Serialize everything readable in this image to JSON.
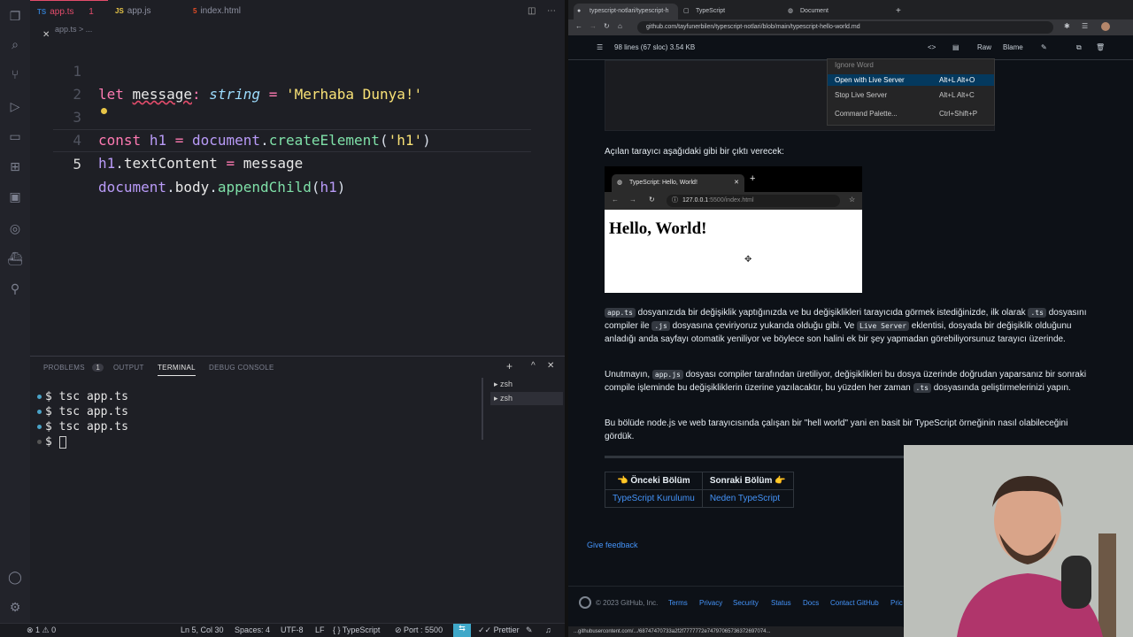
{
  "vscode": {
    "tabs": [
      {
        "icon": "TS",
        "label": "app.ts",
        "badge": "1",
        "active": true
      },
      {
        "icon": "JS",
        "label": "app.js",
        "active": false
      },
      {
        "icon": "5",
        "label": "index.html",
        "active": false
      }
    ],
    "breadcrumb": "app.ts > ...",
    "line_numbers": [
      "1",
      "2",
      "3",
      "4",
      "5"
    ],
    "code_lines": [
      "let message: string = 'Merhaba Dunya!'",
      "",
      "const h1 = document.createElement('h1')",
      "h1.textContent = message",
      "document.body.appendChild(h1)"
    ],
    "panel": {
      "tabs": [
        "PROBLEMS",
        "OUTPUT",
        "TERMINAL",
        "DEBUG CONSOLE"
      ],
      "problems_count": "1",
      "terminal_lines": [
        "$ tsc app.ts",
        "$ tsc app.ts",
        "$ tsc app.ts",
        "$"
      ],
      "shells": [
        "zsh",
        "zsh"
      ]
    },
    "status": {
      "errors": "⊗ 1 ⚠ 0",
      "position": "Ln 5, Col 30",
      "spaces": "Spaces: 4",
      "encoding": "UTF-8",
      "eol": "LF",
      "language": "{ } TypeScript",
      "port": "⊘ Port : 5500",
      "prettier": "✓✓ Prettier"
    }
  },
  "browser": {
    "tabs": [
      "typescript-notlari/typescript-h",
      "TypeScript",
      "Document"
    ],
    "url": "github.com/tayfunerbilen/typescript-notlari/blob/main/typescript-hello-world.md",
    "file_info": "98 lines (67 sloc)   3.54 KB",
    "raw": "Raw",
    "blame": "Blame",
    "menu": [
      {
        "label": "Ignore Word",
        "key": ""
      },
      {
        "label": "Open with Live Server",
        "key": "Alt+L Alt+O"
      },
      {
        "label": "Stop Live Server",
        "key": "Alt+L Alt+C"
      },
      {
        "label": "Command Palette...",
        "key": "Ctrl+Shift+P"
      }
    ],
    "intro": "Açılan tarayıcı aşağıdaki gibi bir çıktı verecek:",
    "shot": {
      "tab": "TypeScript: Hello, World!",
      "url_host": "127.0.0.1",
      "url_rest": ":5500/index.html",
      "heading": "Hello, World!"
    },
    "para1": {
      "a": "app.ts",
      "b": " dosyanızıda bir değişiklik yaptığınızda ve bu değişiklikleri tarayıcıda görmek istediğinizde, ilk olarak ",
      "c": ".ts",
      "d": " dosyasını compiler ile ",
      "e": ".js",
      "f": " dosyasına çeviriyoruz yukarıda olduğu gibi. Ve ",
      "g": "Live Server",
      "h": " eklentisi, dosyada bir değişiklik olduğunu anladığı anda sayfayı otomatik yeniliyor ve böylece son halini ek bir şey yapmadan görebiliyorsunuz tarayıcı üzerinde."
    },
    "para2": {
      "a": "Unutmayın, ",
      "b": "app.js",
      "c": " dosyası compiler tarafından üretiliyor, değişiklikleri bu dosya üzerinde doğrudan yaparsanız bir sonraki compile işleminde bu değişikliklerin üzerine yazılacaktır, bu yüzden her zaman ",
      "d": ".ts",
      "e": " dosyasında geliştirmelerinizi yapın."
    },
    "para3": "Bu bölüde node.js ve web tarayıcısında çalışan bir \"hell world\" yani en basit bir TypeScript örneğinin nasıl olabileceğini gördük.",
    "nav": {
      "prev_head": "👈 Önceki Bölüm",
      "next_head": "Sonraki Bölüm 👉",
      "prev_link": "TypeScript Kurulumu",
      "next_link": "Neden TypeScript"
    },
    "feedback": "Give feedback",
    "footer": [
      "© 2023 GitHub, Inc.",
      "Terms",
      "Privacy",
      "Security",
      "Status",
      "Docs",
      "Contact GitHub",
      "Pric"
    ],
    "statusbar_url": "...githubusercontent.com/.../68747470733a2f2f7777772e74797065736372697074..."
  }
}
